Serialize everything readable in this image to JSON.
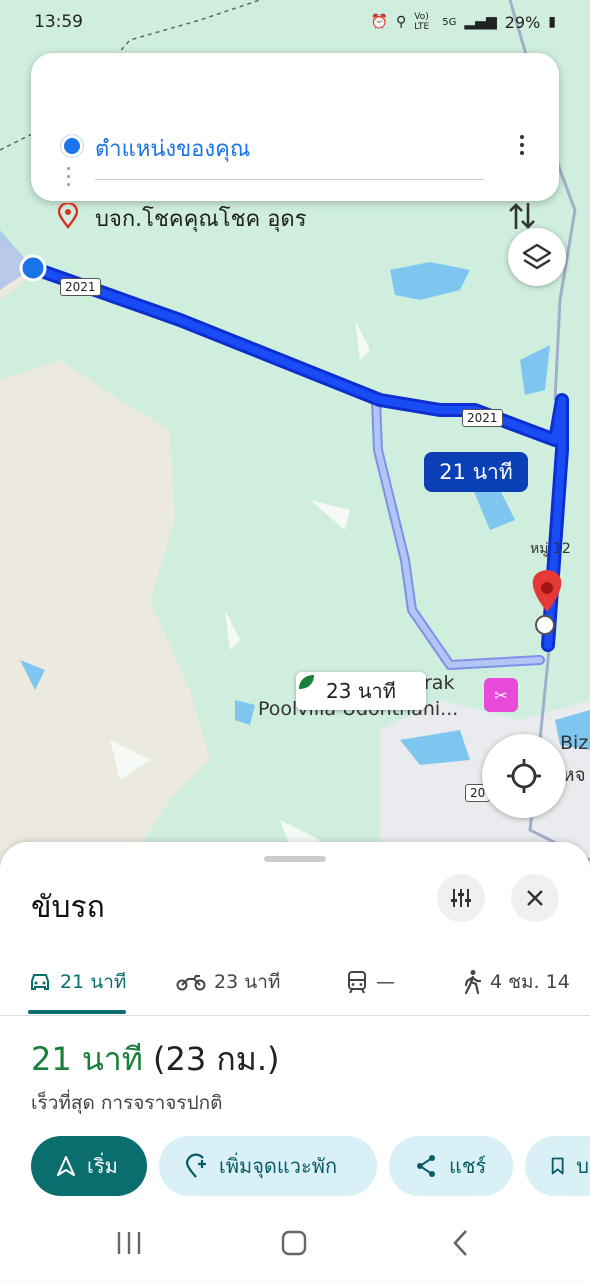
{
  "status_bar": {
    "time": "13:59",
    "network_label": "Vo) LTE",
    "signal_label": "5G",
    "battery": "29%"
  },
  "search": {
    "origin": "ตำแหน่งของคุณ",
    "destination": "บจก.โชคคุณโชค อุดร"
  },
  "map": {
    "road_shield": "2021",
    "road_shield_2": "2021",
    "road_shield_3": "20",
    "main_route_time": "21 นาที",
    "alt_route_time": "23 นาที",
    "place_moo": "หมู่ 12",
    "place_poolvilla_1": "rak",
    "place_poolvilla_2": "Poolvilla Udonthani...",
    "place_biz_1": "Biz",
    "place_biz_2": "หจ",
    "colors": {
      "route": "#1a3ff0",
      "alt_route": "#a5b9f5",
      "pin": "#e53935"
    }
  },
  "sheet": {
    "mode_title": "ขับรถ",
    "tabs": [
      {
        "icon": "car-icon",
        "label": "21 นาที"
      },
      {
        "icon": "motorcycle-icon",
        "label": "23 นาที"
      },
      {
        "icon": "transit-icon",
        "label": "—"
      },
      {
        "icon": "walk-icon",
        "label": "4 ชม. 14"
      }
    ],
    "route_time": "21 นาที",
    "route_distance": "(23 กม.)",
    "route_description": "เร็วที่สุด การจราจรปกติ",
    "actions": {
      "start": "เริ่ม",
      "add_stop": "เพิ่มจุดแวะพัก",
      "share": "แชร์",
      "save": "บ"
    }
  }
}
